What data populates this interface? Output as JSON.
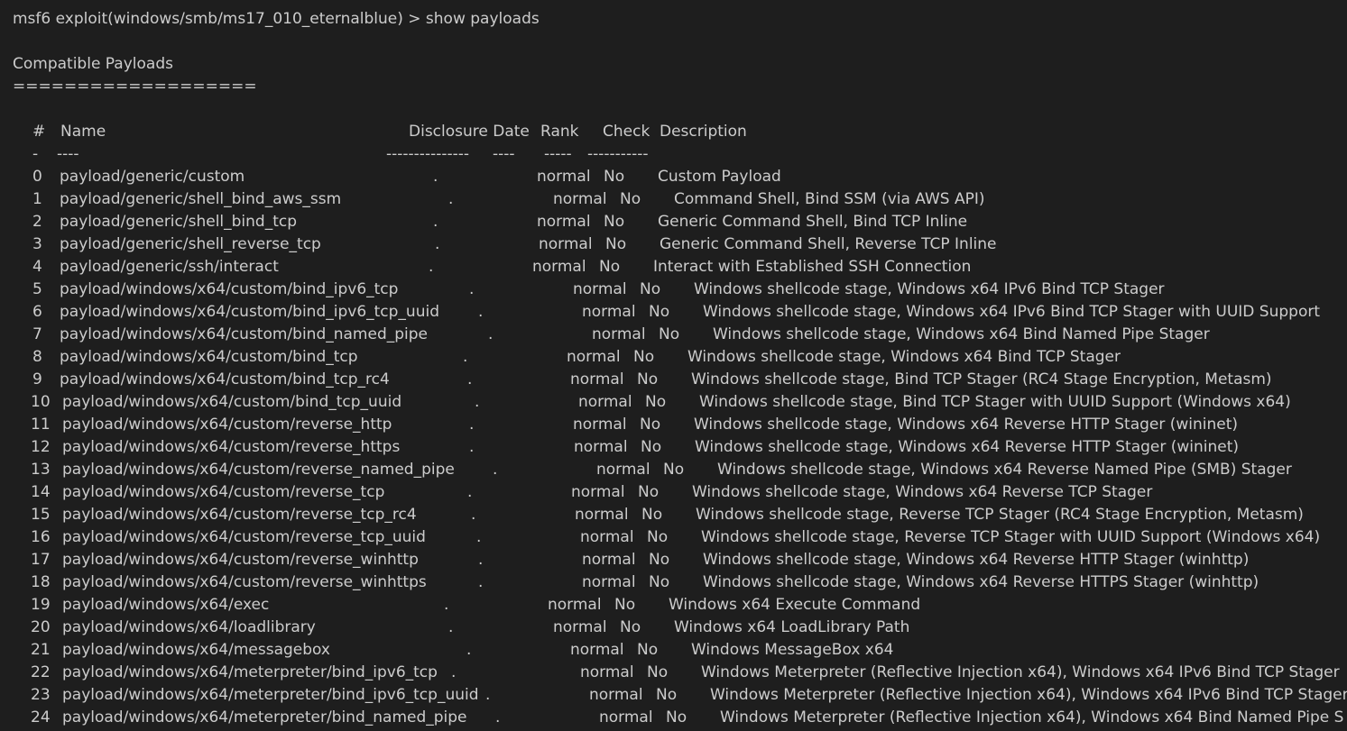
{
  "terminal": {
    "prompt_line": "msf6 exploit(windows/smb/ms17_010_eternalblue) > show payloads",
    "section_title": "Compatible Payloads",
    "section_underline": "===================",
    "headers": {
      "num": "#",
      "name": "Name",
      "date": "Disclosure Date",
      "rank": "Rank",
      "check": "Check",
      "desc": "Description"
    },
    "header_underline": {
      "num": "-",
      "name": "----",
      "date": "---------------",
      "rank": "----",
      "check": "-----",
      "desc": "-----------"
    },
    "rows": [
      {
        "num": "0",
        "name": "payload/generic/custom",
        "date": ".",
        "rank": "normal",
        "check": "No",
        "desc": "Custom Payload"
      },
      {
        "num": "1",
        "name": "payload/generic/shell_bind_aws_ssm",
        "date": ".",
        "rank": "normal",
        "check": "No",
        "desc": "Command Shell, Bind SSM (via AWS API)"
      },
      {
        "num": "2",
        "name": "payload/generic/shell_bind_tcp",
        "date": ".",
        "rank": "normal",
        "check": "No",
        "desc": "Generic Command Shell, Bind TCP Inline"
      },
      {
        "num": "3",
        "name": "payload/generic/shell_reverse_tcp",
        "date": ".",
        "rank": "normal",
        "check": "No",
        "desc": "Generic Command Shell, Reverse TCP Inline"
      },
      {
        "num": "4",
        "name": "payload/generic/ssh/interact",
        "date": ".",
        "rank": "normal",
        "check": "No",
        "desc": "Interact with Established SSH Connection"
      },
      {
        "num": "5",
        "name": "payload/windows/x64/custom/bind_ipv6_tcp",
        "date": ".",
        "rank": "normal",
        "check": "No",
        "desc": "Windows shellcode stage, Windows x64 IPv6 Bind TCP Stager"
      },
      {
        "num": "6",
        "name": "payload/windows/x64/custom/bind_ipv6_tcp_uuid",
        "date": ".",
        "rank": "normal",
        "check": "No",
        "desc": "Windows shellcode stage, Windows x64 IPv6 Bind TCP Stager with UUID Support"
      },
      {
        "num": "7",
        "name": "payload/windows/x64/custom/bind_named_pipe",
        "date": ".",
        "rank": "normal",
        "check": "No",
        "desc": "Windows shellcode stage, Windows x64 Bind Named Pipe Stager"
      },
      {
        "num": "8",
        "name": "payload/windows/x64/custom/bind_tcp",
        "date": ".",
        "rank": "normal",
        "check": "No",
        "desc": "Windows shellcode stage, Windows x64 Bind TCP Stager"
      },
      {
        "num": "9",
        "name": "payload/windows/x64/custom/bind_tcp_rc4",
        "date": ".",
        "rank": "normal",
        "check": "No",
        "desc": "Windows shellcode stage, Bind TCP Stager (RC4 Stage Encryption, Metasm)"
      },
      {
        "num": "10",
        "name": "payload/windows/x64/custom/bind_tcp_uuid",
        "date": ".",
        "rank": "normal",
        "check": "No",
        "desc": "Windows shellcode stage, Bind TCP Stager with UUID Support (Windows x64)"
      },
      {
        "num": "11",
        "name": "payload/windows/x64/custom/reverse_http",
        "date": ".",
        "rank": "normal",
        "check": "No",
        "desc": "Windows shellcode stage, Windows x64 Reverse HTTP Stager (wininet)"
      },
      {
        "num": "12",
        "name": "payload/windows/x64/custom/reverse_https",
        "date": ".",
        "rank": "normal",
        "check": "No",
        "desc": "Windows shellcode stage, Windows x64 Reverse HTTP Stager (wininet)"
      },
      {
        "num": "13",
        "name": "payload/windows/x64/custom/reverse_named_pipe",
        "date": ".",
        "rank": "normal",
        "check": "No",
        "desc": "Windows shellcode stage, Windows x64 Reverse Named Pipe (SMB) Stager"
      },
      {
        "num": "14",
        "name": "payload/windows/x64/custom/reverse_tcp",
        "date": ".",
        "rank": "normal",
        "check": "No",
        "desc": "Windows shellcode stage, Windows x64 Reverse TCP Stager"
      },
      {
        "num": "15",
        "name": "payload/windows/x64/custom/reverse_tcp_rc4",
        "date": ".",
        "rank": "normal",
        "check": "No",
        "desc": "Windows shellcode stage, Reverse TCP Stager (RC4 Stage Encryption, Metasm)"
      },
      {
        "num": "16",
        "name": "payload/windows/x64/custom/reverse_tcp_uuid",
        "date": ".",
        "rank": "normal",
        "check": "No",
        "desc": "Windows shellcode stage, Reverse TCP Stager with UUID Support (Windows x64)"
      },
      {
        "num": "17",
        "name": "payload/windows/x64/custom/reverse_winhttp",
        "date": ".",
        "rank": "normal",
        "check": "No",
        "desc": "Windows shellcode stage, Windows x64 Reverse HTTP Stager (winhttp)"
      },
      {
        "num": "18",
        "name": "payload/windows/x64/custom/reverse_winhttps",
        "date": ".",
        "rank": "normal",
        "check": "No",
        "desc": "Windows shellcode stage, Windows x64 Reverse HTTPS Stager (winhttp)"
      },
      {
        "num": "19",
        "name": "payload/windows/x64/exec",
        "date": ".",
        "rank": "normal",
        "check": "No",
        "desc": "Windows x64 Execute Command"
      },
      {
        "num": "20",
        "name": "payload/windows/x64/loadlibrary",
        "date": ".",
        "rank": "normal",
        "check": "No",
        "desc": "Windows x64 LoadLibrary Path"
      },
      {
        "num": "21",
        "name": "payload/windows/x64/messagebox",
        "date": ".",
        "rank": "normal",
        "check": "No",
        "desc": "Windows MessageBox x64"
      },
      {
        "num": "22",
        "name": "payload/windows/x64/meterpreter/bind_ipv6_tcp",
        "date": ".",
        "rank": "normal",
        "check": "No",
        "desc": "Windows Meterpreter (Reflective Injection x64), Windows x64 IPv6 Bind TCP Stager"
      },
      {
        "num": "23",
        "name": "payload/windows/x64/meterpreter/bind_ipv6_tcp_uuid",
        "date": ".",
        "rank": "normal",
        "check": "No",
        "desc": "Windows Meterpreter (Reflective Injection x64), Windows x64 IPv6 Bind TCP Stager"
      },
      {
        "num": "24",
        "name": "payload/windows/x64/meterpreter/bind_named_pipe",
        "date": ".",
        "rank": "normal",
        "check": "No",
        "desc": "Windows Meterpreter (Reflective Injection x64), Windows x64 Bind Named Pipe S"
      }
    ]
  }
}
